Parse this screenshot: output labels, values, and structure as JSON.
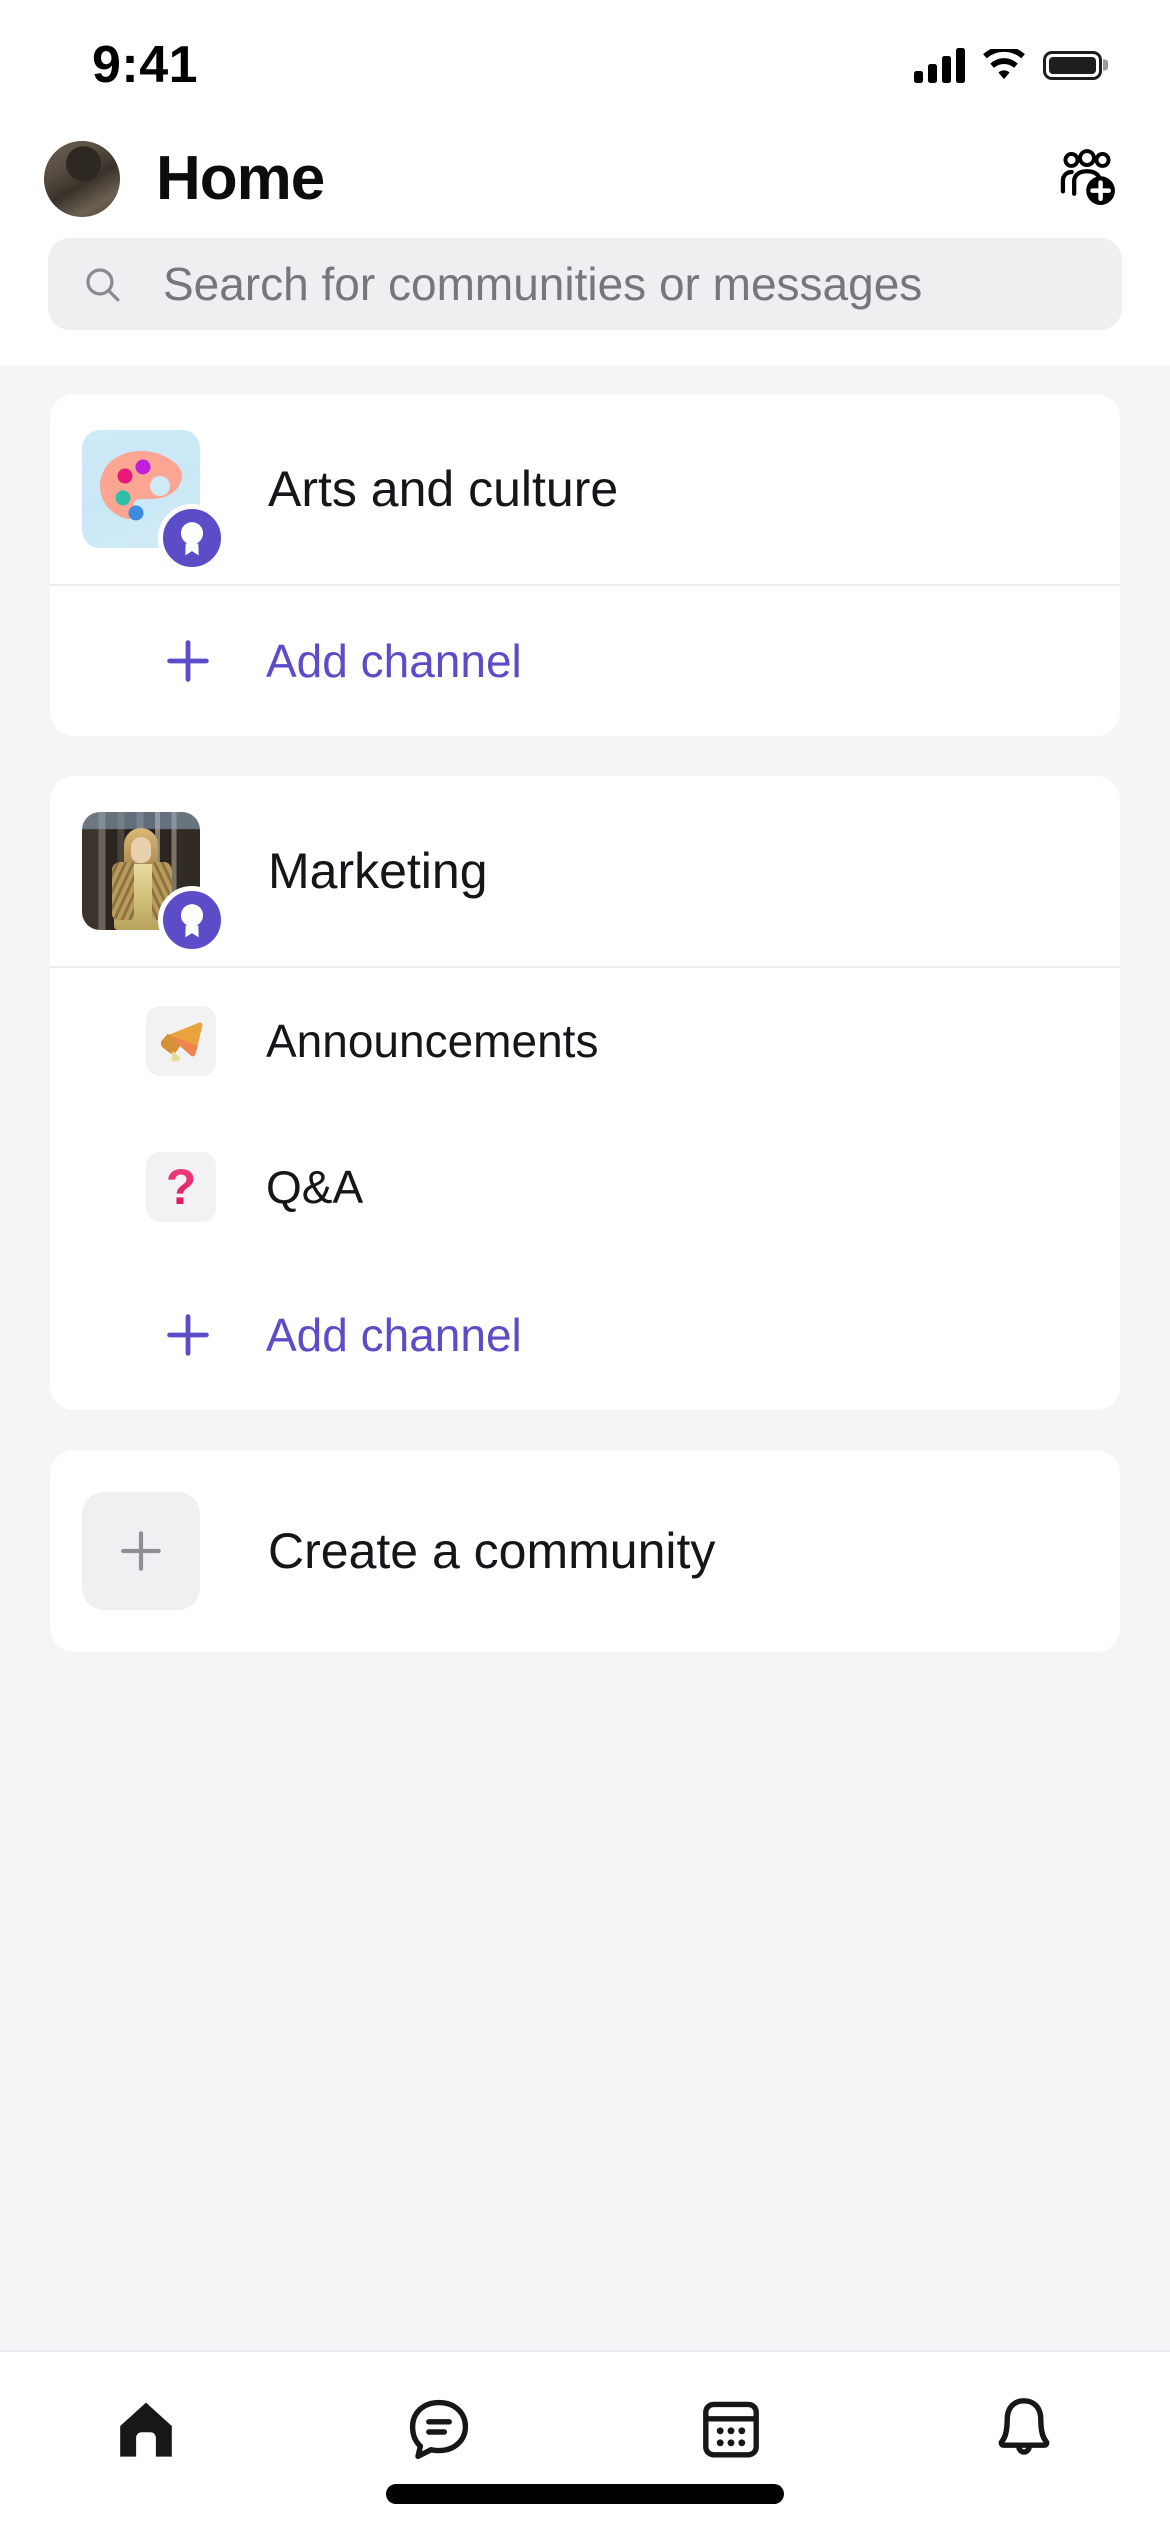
{
  "status_bar": {
    "time": "9:41",
    "signal_icon": "cellular-bars-icon",
    "wifi_icon": "wifi-icon",
    "battery_icon": "battery-full-icon"
  },
  "header": {
    "title": "Home",
    "avatar_name": "user-avatar",
    "action_icon": "add-people-icon"
  },
  "search": {
    "placeholder": "Search for communities or messages",
    "value": "",
    "icon": "search-icon"
  },
  "communities": [
    {
      "name": "Arts and culture",
      "avatar_type": "art-palette-emoji",
      "badge_icon": "award-badge-icon",
      "channels": [],
      "add_channel_label": "Add channel"
    },
    {
      "name": "Marketing",
      "avatar_type": "photo",
      "badge_icon": "award-badge-icon",
      "channels": [
        {
          "name": "Announcements",
          "icon": "megaphone-icon"
        },
        {
          "name": "Q&A",
          "icon": "question-mark-icon"
        }
      ],
      "add_channel_label": "Add channel"
    }
  ],
  "create_community": {
    "label": "Create a community",
    "icon": "plus-icon"
  },
  "tab_bar": {
    "tabs": [
      {
        "name": "home",
        "icon": "home-icon",
        "active": true
      },
      {
        "name": "chat",
        "icon": "chat-bubble-icon",
        "active": false
      },
      {
        "name": "calendar",
        "icon": "calendar-icon",
        "active": false
      },
      {
        "name": "activity",
        "icon": "bell-icon",
        "active": false
      }
    ]
  },
  "colors": {
    "accent": "#5b4dc7",
    "page_bg": "#f5f5f7",
    "card_bg": "#ffffff",
    "text_primary": "#15151a",
    "text_secondary": "#76767c"
  }
}
